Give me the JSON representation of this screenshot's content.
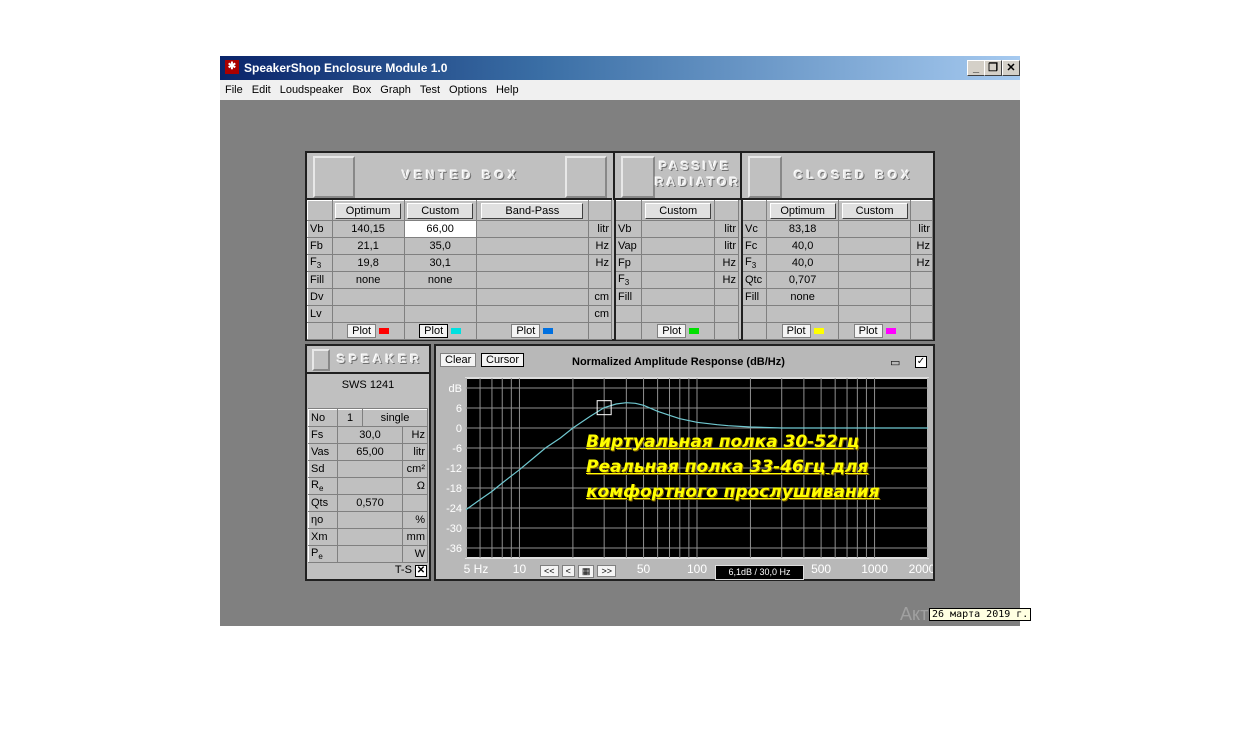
{
  "window": {
    "title": "SpeakerShop Enclosure Module 1.0",
    "controls": [
      "_",
      "❐",
      "✕"
    ]
  },
  "menu": [
    "File",
    "Edit",
    "Loudspeaker",
    "Box",
    "Graph",
    "Test",
    "Options",
    "Help"
  ],
  "vented": {
    "title": "VENTED BOX",
    "buttons": [
      "Optimum",
      "Custom",
      "Band-Pass"
    ],
    "rows": [
      {
        "label": "Vb",
        "opt": "140,15",
        "cus": "66,00",
        "unit": "litr"
      },
      {
        "label": "Fb",
        "opt": "21,1",
        "cus": "35,0",
        "unit": "Hz"
      },
      {
        "label": "F3",
        "opt": "19,8",
        "cus": "30,1",
        "unit": "Hz"
      },
      {
        "label": "Fill",
        "opt": "none",
        "cus": "none",
        "unit": ""
      },
      {
        "label": "Dv",
        "opt": "",
        "cus": "",
        "unit": "cm"
      },
      {
        "label": "Lv",
        "opt": "",
        "cus": "",
        "unit": "cm"
      }
    ],
    "plot": "Plot",
    "colors": [
      "#ff0000",
      "#00e0e0",
      "#0070e0"
    ]
  },
  "passive": {
    "title1": "PASSIVE",
    "title2": "RADIATOR",
    "button": "Custom",
    "rows": [
      {
        "label": "Vb",
        "unit": "litr"
      },
      {
        "label": "Vap",
        "unit": "litr"
      },
      {
        "label": "Fp",
        "unit": "Hz"
      },
      {
        "label": "F3",
        "unit": "Hz"
      },
      {
        "label": "Fill",
        "unit": ""
      },
      {
        "label": "",
        "unit": ""
      }
    ],
    "plot": "Plot",
    "color": "#00e000"
  },
  "closed": {
    "title": "CLOSED BOX",
    "buttons": [
      "Optimum",
      "Custom"
    ],
    "rows": [
      {
        "label": "Vc",
        "opt": "83,18",
        "unit": "litr"
      },
      {
        "label": "Fc",
        "opt": "40,0",
        "unit": "Hz"
      },
      {
        "label": "F3",
        "opt": "40,0",
        "unit": "Hz"
      },
      {
        "label": "Qtc",
        "opt": "0,707",
        "unit": ""
      },
      {
        "label": "Fill",
        "opt": "none",
        "unit": ""
      },
      {
        "label": "",
        "opt": "",
        "unit": ""
      }
    ],
    "plot": "Plot",
    "colors": [
      "#ffff00",
      "#ff00ff"
    ]
  },
  "speaker": {
    "title": "SPEAKER",
    "name": "SWS 1241",
    "no_label": "No",
    "no": "1",
    "mode": "single",
    "rows": [
      {
        "label": "Fs",
        "value": "30,0",
        "unit": "Hz"
      },
      {
        "label": "Vas",
        "value": "65,00",
        "unit": "litr"
      },
      {
        "label": "Sd",
        "value": "",
        "unit": "cm²"
      },
      {
        "label": "Re",
        "value": "",
        "unit": "Ω"
      },
      {
        "label": "Qts",
        "value": "0,570",
        "unit": ""
      },
      {
        "label": "ηo",
        "value": "",
        "unit": "%"
      },
      {
        "label": "Xm",
        "value": "",
        "unit": "mm"
      },
      {
        "label": "Pe",
        "value": "",
        "unit": "W"
      }
    ],
    "ts": "T-S",
    "ts_checked": true
  },
  "graph": {
    "clear": "Clear",
    "cursor": "Cursor",
    "title": "Normalized Amplitude Response (dB/Hz)",
    "checked": true,
    "nav": [
      "<<",
      "<",
      "▦",
      ">>"
    ],
    "readout": "6,1dB / 30,0 Hz",
    "annotations": [
      "Виртуальная полка 30-52гц",
      "Реальная полка 33-46гц для",
      "комфортного прослушивания"
    ]
  },
  "chart_data": {
    "type": "line",
    "xscale": "log",
    "xlim": [
      5,
      2000
    ],
    "ylim": [
      -39,
      15
    ],
    "ylabel": "dB",
    "yticks": [
      "dB",
      "6",
      "0",
      "-6",
      "-12",
      "-18",
      "-24",
      "-30",
      "-36"
    ],
    "xticks": [
      {
        "v": 5,
        "label": "5 Hz"
      },
      {
        "v": 10,
        "label": "10"
      },
      {
        "v": 50,
        "label": "50"
      },
      {
        "v": 100,
        "label": "100"
      },
      {
        "v": 500,
        "label": "500"
      },
      {
        "v": 1000,
        "label": "1000"
      },
      {
        "v": 2000,
        "label": "2000"
      }
    ],
    "series": [
      {
        "color": "#70c8d0",
        "x": [
          5,
          6,
          7,
          8,
          10,
          12,
          14,
          17,
          20,
          25,
          30,
          35,
          40,
          45,
          50,
          60,
          70,
          80,
          100,
          130,
          150,
          200,
          300,
          500,
          1000,
          2000
        ],
        "y": [
          -24.5,
          -21.5,
          -19,
          -16.5,
          -12.5,
          -9,
          -6,
          -3,
          0,
          3.5,
          6.1,
          7.2,
          7.6,
          7.4,
          6.8,
          5,
          3.8,
          2.8,
          1.7,
          1,
          0.7,
          0.3,
          0,
          0,
          0,
          0
        ]
      }
    ],
    "cursor": {
      "x": 30,
      "y": 6.1
    },
    "grid": true
  },
  "taskbar": {
    "watermark": "Акт",
    "date": "26 марта 2019 г."
  }
}
